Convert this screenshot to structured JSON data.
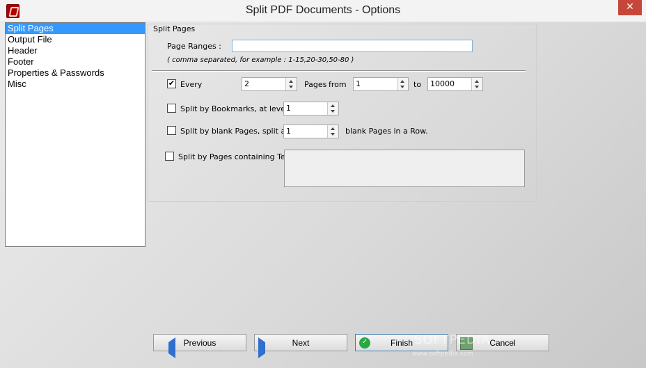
{
  "window": {
    "title": "Split PDF Documents - Options",
    "close_glyph": "✕"
  },
  "left_list": {
    "items": [
      {
        "label": "Split Pages",
        "selected": true
      },
      {
        "label": "Output File",
        "selected": false
      },
      {
        "label": "Header",
        "selected": false
      },
      {
        "label": "Footer",
        "selected": false
      },
      {
        "label": "Properties & Passwords",
        "selected": false
      },
      {
        "label": "Misc",
        "selected": false
      }
    ]
  },
  "split_pages": {
    "group_title": "Split Pages",
    "page_ranges_label": "Page Ranges :",
    "page_ranges_value": "",
    "page_ranges_note": "( comma separated, for example : 1-15,20-30,50-80 )",
    "every": {
      "checked": true,
      "label": "Every",
      "value": "2",
      "pages_label": "Pages",
      "from_label": "from",
      "from_value": "1",
      "to_label": "to",
      "to_value": "10000"
    },
    "bookmarks": {
      "checked": false,
      "label": "Split by Bookmarks, at level :",
      "value": "1"
    },
    "blank_pages": {
      "checked": false,
      "label": "Split by blank Pages, split after",
      "value": "1",
      "suffix": "blank Pages in a Row."
    },
    "containing_text": {
      "checked": false,
      "label": "Split by Pages containing Text :",
      "value": ""
    }
  },
  "buttons": {
    "previous": "Previous",
    "next": "Next",
    "finish": "Finish",
    "cancel": "Cancel"
  },
  "watermark": {
    "main": "SOFTPEDIA",
    "sub": "www.softpedia.com"
  },
  "icons": {
    "check_mark": "✓",
    "checkbox_checked": "✔"
  },
  "colors": {
    "selection": "#3399ff",
    "close_button": "#c7463a"
  }
}
